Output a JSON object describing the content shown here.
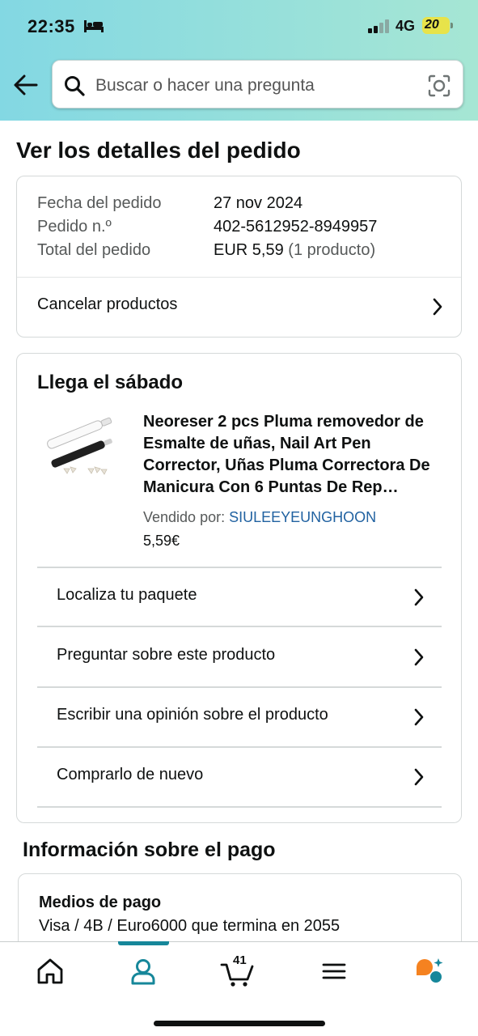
{
  "status_bar": {
    "time": "22:35",
    "network": "4G",
    "battery": "20"
  },
  "search": {
    "placeholder": "Buscar o hacer una pregunta"
  },
  "page": {
    "title": "Ver los detalles del pedido"
  },
  "order_summary": {
    "rows": [
      {
        "label": "Fecha del pedido",
        "value": "27 nov 2024"
      },
      {
        "label": "Pedido n.º",
        "value": "402-5612952-8949957"
      },
      {
        "label": "Total del pedido",
        "value": "EUR 5,59",
        "extra": "(1 producto)"
      }
    ],
    "cancel_label": "Cancelar productos"
  },
  "shipment": {
    "title": "Llega el sábado",
    "product": {
      "title": "Neoreser 2 pcs Pluma removedor de Esmalte de uñas, Nail Art Pen Corrector, Uñas Pluma Correctora De Manicura Con 6 Puntas De Rep…",
      "sold_by_label": "Vendido por:",
      "seller": "SIULEEYEUNGHOON",
      "price": "5,59€"
    },
    "actions": [
      "Localiza tu paquete",
      "Preguntar sobre este producto",
      "Escribir una opinión sobre el producto",
      "Comprarlo de nuevo"
    ]
  },
  "payment": {
    "title": "Información sobre el pago",
    "method_label": "Medios de pago",
    "method_value": "Visa / 4B / Euro6000  que termina en 2055"
  },
  "tabbar": {
    "cart_count": "41",
    "active": "account",
    "colors": {
      "active": "#16879a",
      "accent": "#f58220"
    }
  }
}
